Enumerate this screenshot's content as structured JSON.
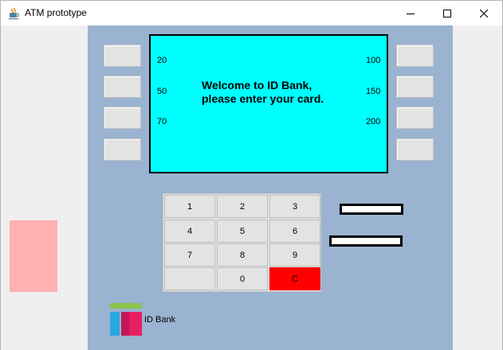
{
  "window": {
    "title": "ATM prototype",
    "icon": "java-cup-icon",
    "controls": [
      "minimize-icon",
      "maximize-icon",
      "close-icon"
    ]
  },
  "screen": {
    "message": "Welcome to ID Bank, please enter your card.",
    "left_amounts": [
      "20",
      "50",
      "70"
    ],
    "right_amounts": [
      "100",
      "150",
      "200"
    ],
    "background": "#00ffff"
  },
  "keypad": {
    "keys": [
      "1",
      "2",
      "3",
      "4",
      "5",
      "6",
      "7",
      "8",
      "9",
      "",
      "0",
      "C"
    ],
    "clear_color": "#ff0000"
  },
  "bank": {
    "name": "ID Bank"
  },
  "colors": {
    "atm_body": "#99b3d1",
    "side_panel": "#ffb0b0",
    "logo_green": "#8bc34a",
    "logo_blue": "#29a8e0",
    "logo_pink": "#e91e63"
  }
}
